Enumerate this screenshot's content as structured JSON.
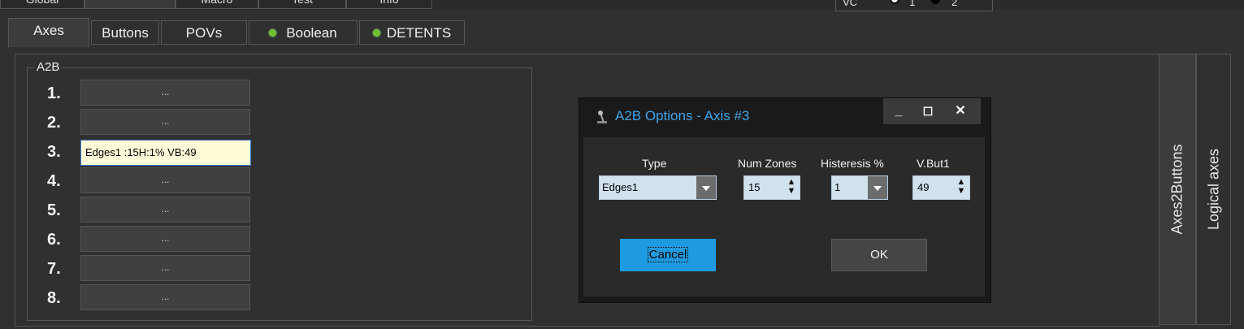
{
  "top_tabs": [
    "Global",
    "",
    "Macro",
    "Test",
    "Info"
  ],
  "vc": {
    "label": "VC",
    "opt1": "1",
    "opt2": "2"
  },
  "tabs": [
    {
      "label": "Axes"
    },
    {
      "label": "Buttons"
    },
    {
      "label": "POVs"
    },
    {
      "label": "Boolean",
      "indicator": "green"
    },
    {
      "label": "DETENTS",
      "indicator": "green"
    }
  ],
  "side_tabs": {
    "axes2buttons": "Axes2Buttons",
    "logical_axes": "Logical axes"
  },
  "group": {
    "title": "A2B",
    "rows": [
      {
        "num": "1.",
        "value": "..."
      },
      {
        "num": "2.",
        "value": "..."
      },
      {
        "num": "3.",
        "value": "Edges1 :15H:1%  VB:49"
      },
      {
        "num": "4.",
        "value": "..."
      },
      {
        "num": "5.",
        "value": "..."
      },
      {
        "num": "6.",
        "value": "..."
      },
      {
        "num": "7.",
        "value": "..."
      },
      {
        "num": "8.",
        "value": "..."
      }
    ]
  },
  "dialog": {
    "title": "A2B Options  -  Axis #3",
    "minimize": "_",
    "maximize": "☐",
    "close": "✕",
    "type_label": "Type",
    "type_value": "Edges1",
    "zones_label": "Num Zones",
    "zones_value": "15",
    "hist_label": "Histeresis %",
    "hist_value": "1",
    "vbut_label": "V.But1",
    "vbut_value": "49",
    "cancel": "Cancel",
    "ok": "OK"
  },
  "colors": {
    "accent": "#1e9be0",
    "title_blue": "#3ea4e6",
    "indicator": "#6fc22c"
  }
}
